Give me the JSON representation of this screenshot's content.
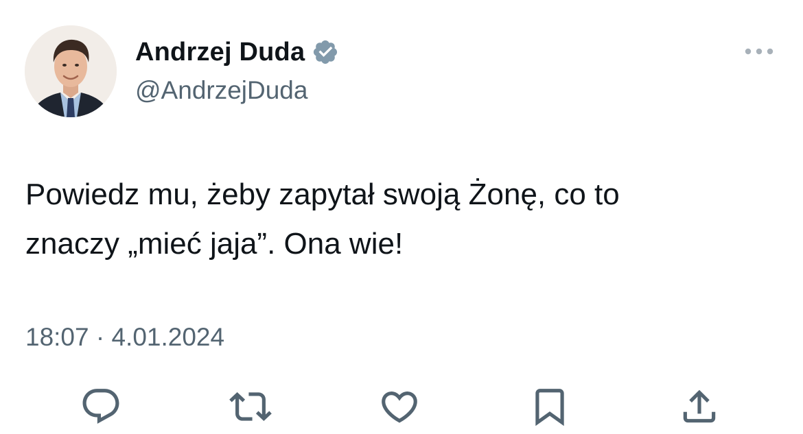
{
  "author": {
    "display_name": "Andrzej Duda",
    "handle": "@AndrzejDuda",
    "verified": true
  },
  "tweet": {
    "lines": [
      "Powiedz mu, żeby zapytał swoją Żonę, co to",
      "znaczy „mieć jaja”. Ona wie!"
    ],
    "time": "18:07",
    "separator": "·",
    "date": "4.01.2024"
  },
  "icons": {
    "more": "more-dots-icon",
    "verified": "verified-badge-icon",
    "reply": "reply-icon",
    "retweet": "retweet-icon",
    "like": "heart-icon",
    "bookmark": "bookmark-icon",
    "share": "share-icon"
  },
  "colors": {
    "text_primary": "#0f1419",
    "text_secondary": "#536471",
    "verified_badge": "#829aab",
    "icon": "#536471"
  }
}
